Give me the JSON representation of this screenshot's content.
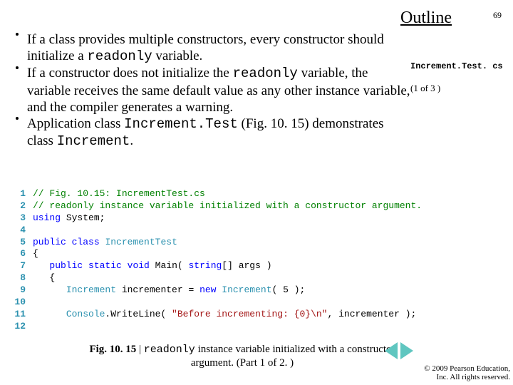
{
  "header": {
    "title": "Outline",
    "page_num": "69"
  },
  "bullets": [
    {
      "pre": "If a class provides multiple constructors, every constructor should initialize a ",
      "code1": "readonly",
      "post": " variable."
    },
    {
      "pre": "If a constructor does not initialize the ",
      "code1": "readonly",
      "mid": " variable, the variable receives the same default value as any other instance variable, and the compiler generates a warning."
    },
    {
      "pre": "Application class ",
      "code1": "Increment.Test",
      "mid": " (Fig. 10. 15) demonstrates class ",
      "code2": "Increment",
      "post": "."
    }
  ],
  "sidemeta": {
    "filename": "Increment.Test. cs",
    "part": "(1 of 3 )"
  },
  "code": {
    "lines": [
      {
        "n": "1",
        "frag": [
          {
            "c": "com",
            "t": "// Fig. 10.15: IncrementTest.cs"
          }
        ]
      },
      {
        "n": "2",
        "frag": [
          {
            "c": "com",
            "t": "// readonly instance variable initialized with a constructor argument."
          }
        ]
      },
      {
        "n": "3",
        "frag": [
          {
            "c": "kw",
            "t": "using"
          },
          {
            "t": " System;"
          }
        ]
      },
      {
        "n": "4",
        "frag": [
          {
            "t": ""
          }
        ]
      },
      {
        "n": "5",
        "frag": [
          {
            "c": "kw",
            "t": "public"
          },
          {
            "t": " "
          },
          {
            "c": "kw",
            "t": "class"
          },
          {
            "t": " "
          },
          {
            "c": "typ",
            "t": "IncrementTest"
          }
        ]
      },
      {
        "n": "6",
        "frag": [
          {
            "t": "{"
          }
        ]
      },
      {
        "n": "7",
        "frag": [
          {
            "t": "   "
          },
          {
            "c": "kw",
            "t": "public"
          },
          {
            "t": " "
          },
          {
            "c": "kw",
            "t": "static"
          },
          {
            "t": " "
          },
          {
            "c": "kw",
            "t": "void"
          },
          {
            "t": " Main( "
          },
          {
            "c": "kw",
            "t": "string"
          },
          {
            "t": "[] args )"
          }
        ]
      },
      {
        "n": "8",
        "frag": [
          {
            "t": "   {"
          }
        ]
      },
      {
        "n": "9",
        "frag": [
          {
            "t": "      "
          },
          {
            "c": "typ",
            "t": "Increment"
          },
          {
            "t": " incrementer = "
          },
          {
            "c": "kw",
            "t": "new"
          },
          {
            "t": " "
          },
          {
            "c": "typ",
            "t": "Increment"
          },
          {
            "t": "( 5 );"
          }
        ]
      },
      {
        "n": "10",
        "frag": [
          {
            "t": ""
          }
        ]
      },
      {
        "n": "11",
        "frag": [
          {
            "t": "      "
          },
          {
            "c": "typ",
            "t": "Console"
          },
          {
            "t": ".WriteLine( "
          },
          {
            "c": "str",
            "t": "\"Before incrementing: {0}\\n\""
          },
          {
            "t": ", incrementer );"
          }
        ]
      },
      {
        "n": "12",
        "frag": [
          {
            "t": ""
          }
        ]
      }
    ]
  },
  "caption": {
    "bold": "Fig. 10. 15 ",
    "sep": "| ",
    "code": "readonly",
    "rest1": " instance variable initialized with a constructor argument. (Part 1 of 2. )"
  },
  "copyright": {
    "line1": "© 2009 Pearson Education,",
    "line2": "Inc.  All rights reserved."
  }
}
